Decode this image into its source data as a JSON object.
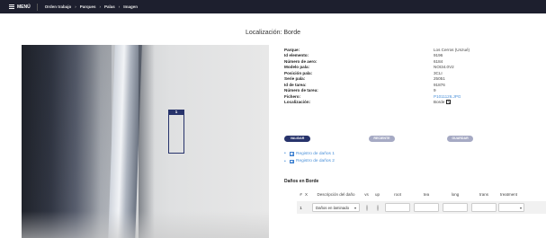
{
  "nav": {
    "menu_label": "MENÚ",
    "breadcrumbs": [
      "Orden trabajo",
      "Parques",
      "Palas",
      "Imagen"
    ]
  },
  "page": {
    "title": "Localización: Borde"
  },
  "image": {
    "damage_tag": "1"
  },
  "details": [
    {
      "label": "Parque:",
      "value": "Los Cerros (Unzué)"
    },
    {
      "label": "Id elemento:",
      "value": "9196"
    },
    {
      "label": "Número de aero:",
      "value": "6184"
    },
    {
      "label": "Modelo pala:",
      "value": "NOI34.0V2"
    },
    {
      "label": "Posición pala:",
      "value": "3CLI"
    },
    {
      "label": "Serie pala:",
      "value": "25051"
    },
    {
      "label": "Id de tarea:",
      "value": "91876"
    },
    {
      "label": "Número de tarea:",
      "value": "9"
    },
    {
      "label": "Fichero:",
      "value": "P1011126.JPG"
    },
    {
      "label": "Localización:",
      "value": "Borde"
    }
  ],
  "actions": {
    "validate": "VALIDAR",
    "recent": "RECIENTE",
    "save": "GUARDAR"
  },
  "links": [
    {
      "label": "Registro de daños 1"
    },
    {
      "label": "Registro de daños 2"
    }
  ],
  "damages": {
    "title": "Daños en Borde",
    "headers": {
      "num": "#",
      "x": "X",
      "desc": "Descripción del daño",
      "vs": "vs",
      "up": "up",
      "root": "root",
      "tea": "tea",
      "long": "long",
      "trans": "trans",
      "treatment": "treatment"
    },
    "rows": [
      {
        "num": "1",
        "description": "Daños en laminado"
      }
    ]
  },
  "colors": {
    "topbar": "#1d1f2e",
    "primary": "#27336b",
    "disabled": "#a6aac4",
    "link": "#4a90d9"
  }
}
